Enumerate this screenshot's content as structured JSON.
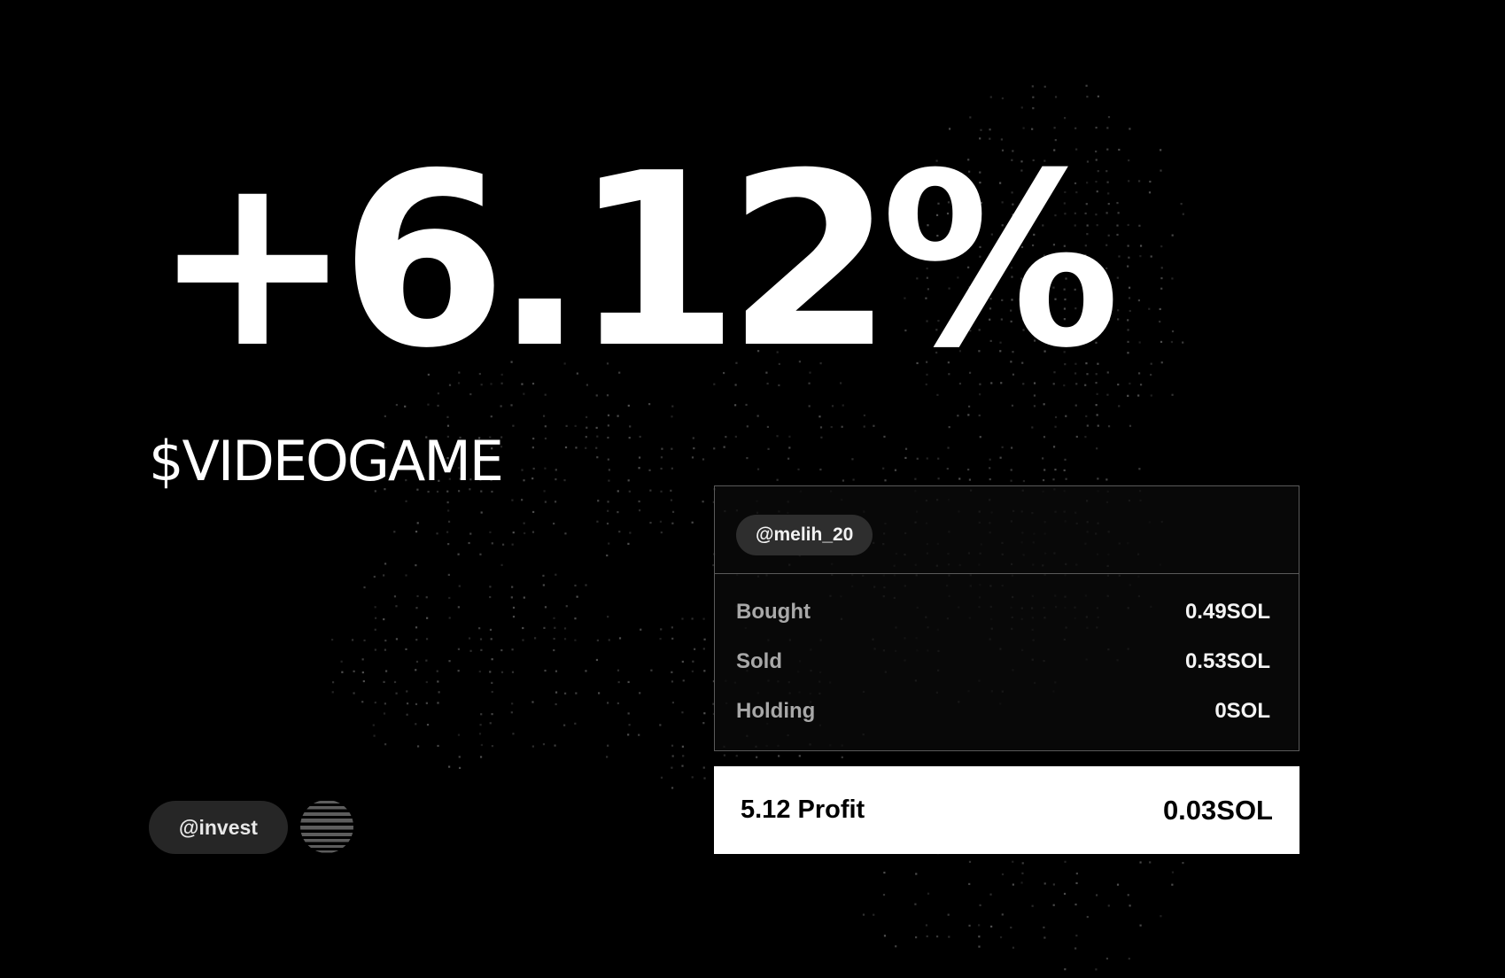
{
  "headline": {
    "percent_change": "+6.12%",
    "ticker": "$VIDEOGAME"
  },
  "trade_card": {
    "user_handle": "@melih_20",
    "rows": [
      {
        "label": "Bought",
        "value": "0.49SOL"
      },
      {
        "label": "Sold",
        "value": "0.53SOL"
      },
      {
        "label": "Holding",
        "value": "0SOL"
      }
    ]
  },
  "profit": {
    "label": "5.12 Profit",
    "value": "0.03SOL"
  },
  "footer": {
    "handle": "@invest",
    "icon": "striped-orb-icon"
  },
  "background": {
    "icon": "ascii-face-art"
  },
  "colors": {
    "background": "#000000",
    "text": "#ffffff",
    "pill": "#2e2e2e",
    "profit_bar": "#ffffff"
  }
}
